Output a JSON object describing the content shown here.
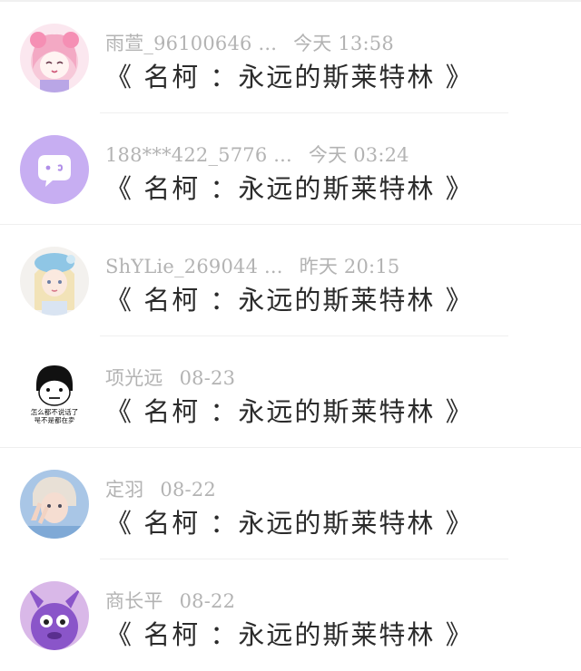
{
  "comments": [
    {
      "avatar": "anime-girl-pink-avatar",
      "username": "雨萱_96100646 ...",
      "time": "今天 13:58",
      "text": "《 名柯 ：永远的斯莱特林 》"
    },
    {
      "avatar": "purple-chat-bubble-avatar",
      "username": "188***422_5776 ...",
      "time": "今天 03:24",
      "text": "《 名柯 ：永远的斯莱特林 》"
    },
    {
      "avatar": "blonde-girl-blue-hat-avatar",
      "username": "ShYLie_269044 ...",
      "time": "昨天 20:15",
      "text": "《 名柯 ：永远的斯莱特林 》"
    },
    {
      "avatar": "meme-face-avatar",
      "avatar_caption_1": "怎么都不说话了",
      "avatar_caption_2": "是不是都在卖",
      "username": "项光远",
      "time": "08-23",
      "text": "《 名柯 ：永远的斯莱特林 》"
    },
    {
      "avatar": "boy-peace-sign-avatar",
      "username": "定羽",
      "time": "08-22",
      "text": "《 名柯 ：永远的斯莱特林 》"
    },
    {
      "avatar": "purple-cartoon-creature-avatar",
      "username": "商长平",
      "time": "08-22",
      "text": "《 名柯 ：永远的斯莱特林 》"
    }
  ]
}
